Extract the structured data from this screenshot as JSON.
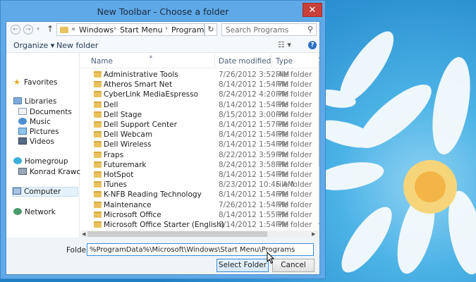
{
  "window": {
    "title": "New Toolbar - Choose a folder",
    "close_glyph": "✕"
  },
  "address": {
    "chevrons": "«",
    "crumbs": [
      "Windows",
      "Start Menu",
      "Programs"
    ],
    "separator": "›",
    "refresh_glyph": "↻",
    "search_placeholder": "Search Programs"
  },
  "toolbar": {
    "organize_label": "Organize ▾",
    "new_folder_label": "New folder",
    "view_glyph": "☷ ▾",
    "help_glyph": "?"
  },
  "nav": {
    "favorites": "Favorites",
    "libraries": "Libraries",
    "documents": "Documents",
    "music": "Music",
    "pictures": "Pictures",
    "videos": "Videos",
    "homegroup": "Homegroup",
    "user": "Konrad Krawczyk",
    "computer": "Computer",
    "network": "Network"
  },
  "columns": {
    "name": "Name",
    "date": "Date modified",
    "type": "Type"
  },
  "files": [
    {
      "name": "Administrative Tools",
      "date": "7/26/2012 3:52 AM",
      "type": "File folder"
    },
    {
      "name": "Atheros Smart Net",
      "date": "8/14/2012 1:54 PM",
      "type": "File folder"
    },
    {
      "name": "CyberLink MediaEspresso",
      "date": "8/24/2012 4:20 PM",
      "type": "File folder"
    },
    {
      "name": "Dell",
      "date": "8/14/2012 1:54 PM",
      "type": "File folder"
    },
    {
      "name": "Dell Stage",
      "date": "8/15/2012 3:00 PM",
      "type": "File folder"
    },
    {
      "name": "Dell Support Center",
      "date": "8/14/2012 1:57 PM",
      "type": "File folder"
    },
    {
      "name": "Dell Webcam",
      "date": "8/14/2012 1:54 PM",
      "type": "File folder"
    },
    {
      "name": "Dell Wireless",
      "date": "8/14/2012 1:54 PM",
      "type": "File folder"
    },
    {
      "name": "Fraps",
      "date": "8/22/2012 3:59 PM",
      "type": "File folder"
    },
    {
      "name": "Futuremark",
      "date": "8/24/2012 3:58 PM",
      "type": "File folder"
    },
    {
      "name": "HotSpot",
      "date": "8/14/2012 1:54 PM",
      "type": "File folder"
    },
    {
      "name": "iTunes",
      "date": "8/23/2012 10:45 AM",
      "type": "File folder"
    },
    {
      "name": "K-NFB Reading Technology",
      "date": "8/14/2012 1:54 PM",
      "type": "File folder"
    },
    {
      "name": "Maintenance",
      "date": "7/26/2012 1:54 PM",
      "type": "File folder"
    },
    {
      "name": "Microsoft Office",
      "date": "8/14/2012 1:55 PM",
      "type": "File folder"
    },
    {
      "name": "Microsoft Office Starter (English)",
      "date": "8/14/2012 1:54 PM",
      "type": "File folder"
    }
  ],
  "bottom": {
    "folder_label": "Folder:",
    "folder_value": "%ProgramData%\\Microsoft\\Windows\\Start Menu\\Programs",
    "select_label": "Select Folder",
    "cancel_label": "Cancel"
  },
  "colors": {
    "accent": "#3c8bd6",
    "titlebar": "#5fa9e8",
    "close": "#c9403a",
    "folder": "#e9c25e"
  }
}
